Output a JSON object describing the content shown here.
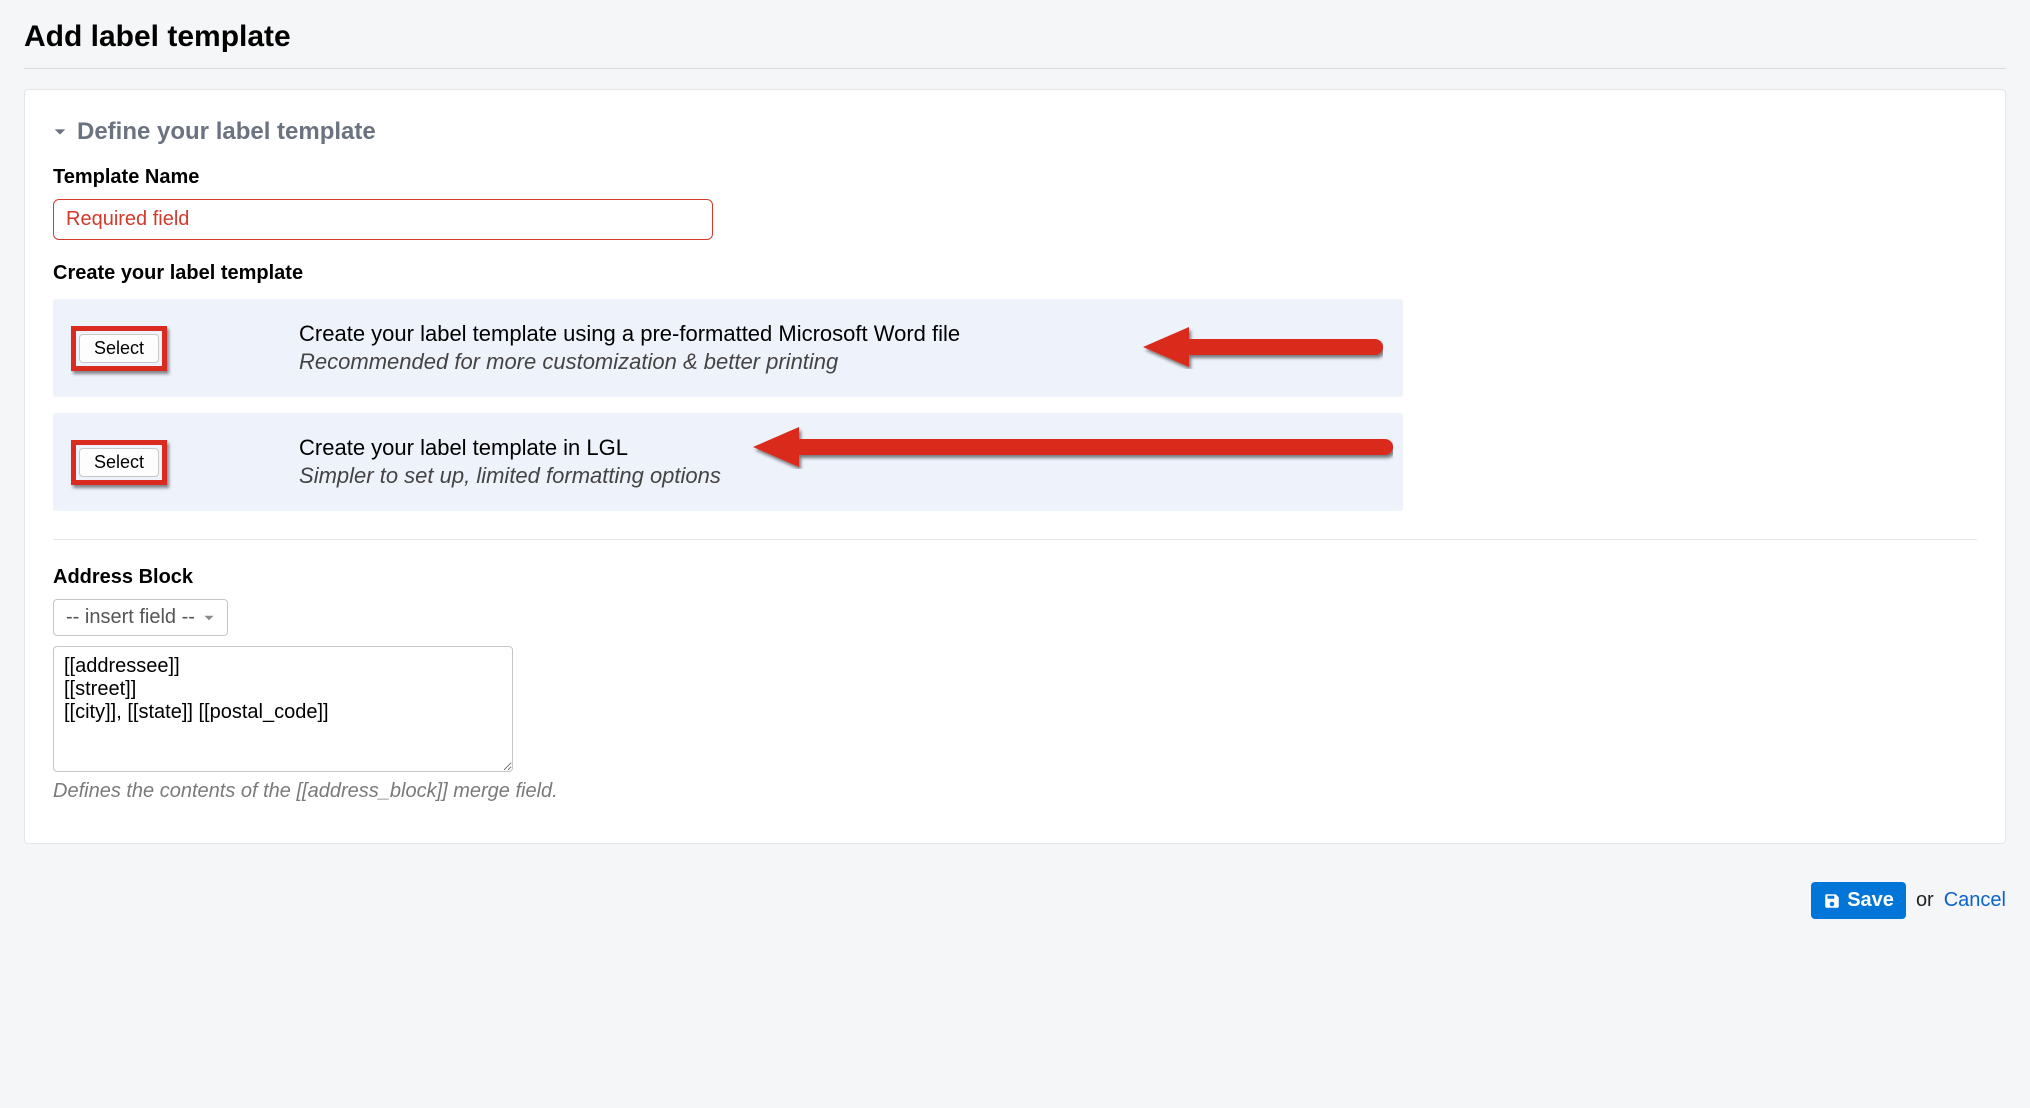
{
  "page": {
    "title": "Add label template"
  },
  "section": {
    "title": "Define your label template"
  },
  "templateName": {
    "label": "Template Name",
    "placeholder": "Required field",
    "value": ""
  },
  "create": {
    "heading": "Create your label template",
    "options": [
      {
        "button": "Select",
        "primary": "Create your label template using a pre-formatted Microsoft Word file",
        "secondary": "Recommended for more customization & better printing"
      },
      {
        "button": "Select",
        "primary": "Create your label template in LGL",
        "secondary": "Simpler to set up, limited formatting options"
      }
    ]
  },
  "addressBlock": {
    "label": "Address Block",
    "dropdown": "-- insert field --",
    "text": "[[addressee]]\n[[street]]\n[[city]], [[state]] [[postal_code]]",
    "helper": "Defines the contents of the [[address_block]] merge field."
  },
  "footer": {
    "save": "Save",
    "or": "or",
    "cancel": "Cancel"
  }
}
